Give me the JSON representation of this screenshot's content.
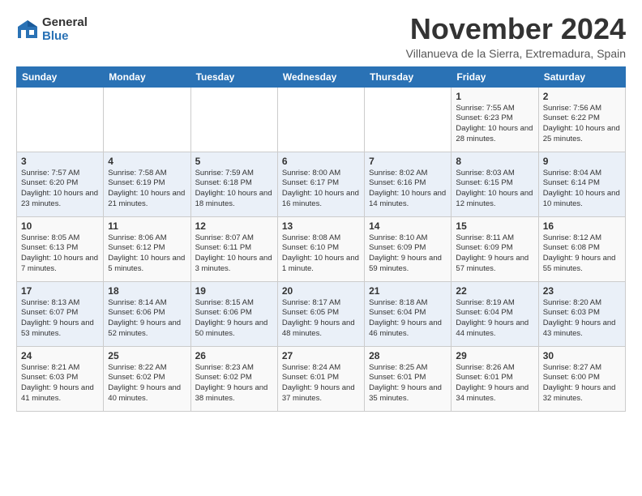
{
  "header": {
    "logo_general": "General",
    "logo_blue": "Blue",
    "month": "November 2024",
    "location": "Villanueva de la Sierra, Extremadura, Spain"
  },
  "days_of_week": [
    "Sunday",
    "Monday",
    "Tuesday",
    "Wednesday",
    "Thursday",
    "Friday",
    "Saturday"
  ],
  "weeks": [
    [
      {
        "num": "",
        "info": ""
      },
      {
        "num": "",
        "info": ""
      },
      {
        "num": "",
        "info": ""
      },
      {
        "num": "",
        "info": ""
      },
      {
        "num": "",
        "info": ""
      },
      {
        "num": "1",
        "info": "Sunrise: 7:55 AM\nSunset: 6:23 PM\nDaylight: 10 hours and 28 minutes."
      },
      {
        "num": "2",
        "info": "Sunrise: 7:56 AM\nSunset: 6:22 PM\nDaylight: 10 hours and 25 minutes."
      }
    ],
    [
      {
        "num": "3",
        "info": "Sunrise: 7:57 AM\nSunset: 6:20 PM\nDaylight: 10 hours and 23 minutes."
      },
      {
        "num": "4",
        "info": "Sunrise: 7:58 AM\nSunset: 6:19 PM\nDaylight: 10 hours and 21 minutes."
      },
      {
        "num": "5",
        "info": "Sunrise: 7:59 AM\nSunset: 6:18 PM\nDaylight: 10 hours and 18 minutes."
      },
      {
        "num": "6",
        "info": "Sunrise: 8:00 AM\nSunset: 6:17 PM\nDaylight: 10 hours and 16 minutes."
      },
      {
        "num": "7",
        "info": "Sunrise: 8:02 AM\nSunset: 6:16 PM\nDaylight: 10 hours and 14 minutes."
      },
      {
        "num": "8",
        "info": "Sunrise: 8:03 AM\nSunset: 6:15 PM\nDaylight: 10 hours and 12 minutes."
      },
      {
        "num": "9",
        "info": "Sunrise: 8:04 AM\nSunset: 6:14 PM\nDaylight: 10 hours and 10 minutes."
      }
    ],
    [
      {
        "num": "10",
        "info": "Sunrise: 8:05 AM\nSunset: 6:13 PM\nDaylight: 10 hours and 7 minutes."
      },
      {
        "num": "11",
        "info": "Sunrise: 8:06 AM\nSunset: 6:12 PM\nDaylight: 10 hours and 5 minutes."
      },
      {
        "num": "12",
        "info": "Sunrise: 8:07 AM\nSunset: 6:11 PM\nDaylight: 10 hours and 3 minutes."
      },
      {
        "num": "13",
        "info": "Sunrise: 8:08 AM\nSunset: 6:10 PM\nDaylight: 10 hours and 1 minute."
      },
      {
        "num": "14",
        "info": "Sunrise: 8:10 AM\nSunset: 6:09 PM\nDaylight: 9 hours and 59 minutes."
      },
      {
        "num": "15",
        "info": "Sunrise: 8:11 AM\nSunset: 6:09 PM\nDaylight: 9 hours and 57 minutes."
      },
      {
        "num": "16",
        "info": "Sunrise: 8:12 AM\nSunset: 6:08 PM\nDaylight: 9 hours and 55 minutes."
      }
    ],
    [
      {
        "num": "17",
        "info": "Sunrise: 8:13 AM\nSunset: 6:07 PM\nDaylight: 9 hours and 53 minutes."
      },
      {
        "num": "18",
        "info": "Sunrise: 8:14 AM\nSunset: 6:06 PM\nDaylight: 9 hours and 52 minutes."
      },
      {
        "num": "19",
        "info": "Sunrise: 8:15 AM\nSunset: 6:06 PM\nDaylight: 9 hours and 50 minutes."
      },
      {
        "num": "20",
        "info": "Sunrise: 8:17 AM\nSunset: 6:05 PM\nDaylight: 9 hours and 48 minutes."
      },
      {
        "num": "21",
        "info": "Sunrise: 8:18 AM\nSunset: 6:04 PM\nDaylight: 9 hours and 46 minutes."
      },
      {
        "num": "22",
        "info": "Sunrise: 8:19 AM\nSunset: 6:04 PM\nDaylight: 9 hours and 44 minutes."
      },
      {
        "num": "23",
        "info": "Sunrise: 8:20 AM\nSunset: 6:03 PM\nDaylight: 9 hours and 43 minutes."
      }
    ],
    [
      {
        "num": "24",
        "info": "Sunrise: 8:21 AM\nSunset: 6:03 PM\nDaylight: 9 hours and 41 minutes."
      },
      {
        "num": "25",
        "info": "Sunrise: 8:22 AM\nSunset: 6:02 PM\nDaylight: 9 hours and 40 minutes."
      },
      {
        "num": "26",
        "info": "Sunrise: 8:23 AM\nSunset: 6:02 PM\nDaylight: 9 hours and 38 minutes."
      },
      {
        "num": "27",
        "info": "Sunrise: 8:24 AM\nSunset: 6:01 PM\nDaylight: 9 hours and 37 minutes."
      },
      {
        "num": "28",
        "info": "Sunrise: 8:25 AM\nSunset: 6:01 PM\nDaylight: 9 hours and 35 minutes."
      },
      {
        "num": "29",
        "info": "Sunrise: 8:26 AM\nSunset: 6:01 PM\nDaylight: 9 hours and 34 minutes."
      },
      {
        "num": "30",
        "info": "Sunrise: 8:27 AM\nSunset: 6:00 PM\nDaylight: 9 hours and 32 minutes."
      }
    ]
  ]
}
